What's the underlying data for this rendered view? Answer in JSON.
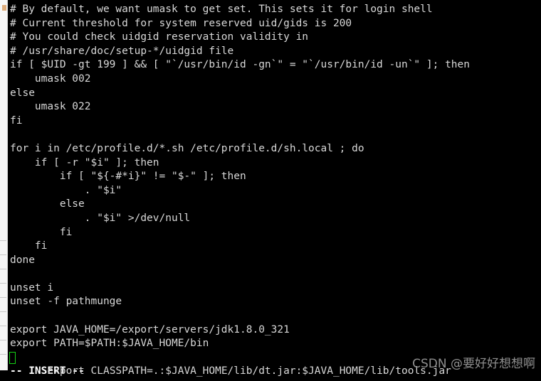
{
  "window": {
    "app": "terminal",
    "background_color": "#000000",
    "foreground_color": "#d8d8d8"
  },
  "gutter": {
    "name": "editor-gutter-strip",
    "background_color": "#f7f7f7",
    "glyph": "bookmark-marker"
  },
  "terminal": {
    "editor_mode": "vim",
    "cursor": {
      "color": "#15d215",
      "shape": "hollow-box",
      "line_index": 25,
      "column": 1
    },
    "lines": [
      "# By default, we want umask to get set. This sets it for login shell",
      "# Current threshold for system reserved uid/gids is 200",
      "# You could check uidgid reservation validity in",
      "# /usr/share/doc/setup-*/uidgid file",
      "if [ $UID -gt 199 ] && [ \"`/usr/bin/id -gn`\" = \"`/usr/bin/id -un`\" ]; then",
      "    umask 002",
      "else",
      "    umask 022",
      "fi",
      "",
      "for i in /etc/profile.d/*.sh /etc/profile.d/sh.local ; do",
      "    if [ -r \"$i\" ]; then",
      "        if [ \"${-#*i}\" != \"$-\" ]; then",
      "            . \"$i\"",
      "        else",
      "            . \"$i\" >/dev/null",
      "        fi",
      "    fi",
      "done",
      "",
      "unset i",
      "unset -f pathmunge",
      "",
      "export JAVA_HOME=/export/servers/jdk1.8.0_321",
      "export PATH=$PATH:$JAVA_HOME/bin",
      "export CLASSPATH=.:$JAVA_HOME/lib/dt.jar:$JAVA_HOME/lib/tools.jar"
    ],
    "status_line": "-- INSERT --"
  },
  "watermark": {
    "text": "CSDN @要好好想想啊",
    "color": "#8f8f8f"
  }
}
